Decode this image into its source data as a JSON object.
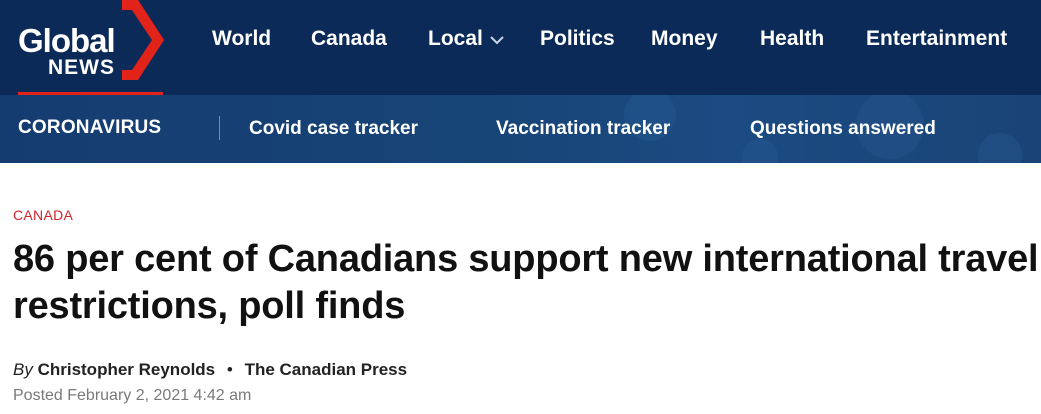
{
  "brand": {
    "name_line1": "Global",
    "name_line2": "NEWS",
    "accent": "#e2231a",
    "primary": "#0b2a57"
  },
  "main_nav": {
    "items": [
      {
        "label": "World"
      },
      {
        "label": "Canada"
      },
      {
        "label": "Local",
        "icon": "chevron-down-icon"
      },
      {
        "label": "Politics"
      },
      {
        "label": "Money"
      },
      {
        "label": "Health"
      },
      {
        "label": "Entertainment"
      }
    ]
  },
  "sub_nav": {
    "section_label": "CORONAVIRUS",
    "items": [
      {
        "label": "Covid case tracker"
      },
      {
        "label": "Vaccination tracker"
      },
      {
        "label": "Questions answered"
      }
    ]
  },
  "article": {
    "category": "CANADA",
    "headline": "86 per cent of Canadians support new international travel restrictions, poll finds",
    "by_prefix": "By",
    "author": "Christopher Reynolds",
    "separator": "•",
    "source": "The Canadian Press",
    "posted": "Posted February 2, 2021 4:42 am"
  }
}
